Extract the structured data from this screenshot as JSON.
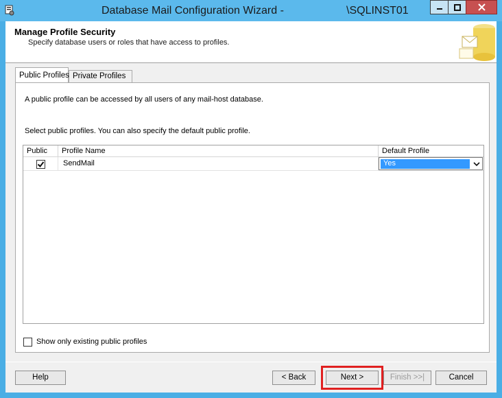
{
  "window": {
    "title": "Database Mail Configuration Wizard -",
    "title_instance": "\\SQLINST01",
    "title_bar_color": "#5bb9ec",
    "close_color": "#c75050"
  },
  "header": {
    "title": "Manage Profile Security",
    "subtitle": "Specify database users or roles that have access to profiles."
  },
  "tabs": [
    {
      "label": "Public Profiles",
      "active": true
    },
    {
      "label": "Private Profiles",
      "active": false
    }
  ],
  "public_tab": {
    "description": "A public profile can be accessed by all users of any mail-host database.",
    "instruction": "Select public profiles. You can also specify the default public profile.",
    "grid": {
      "columns": [
        "Public",
        "Profile Name",
        "Default Profile"
      ],
      "rows": [
        {
          "public": true,
          "profile_name": "SendMail",
          "default_profile": "Yes"
        }
      ]
    },
    "show_existing_label": "Show only existing public profiles",
    "show_existing_checked": false
  },
  "buttons": {
    "help": "Help",
    "back": "< Back",
    "next": "Next >",
    "finish": "Finish >>|",
    "cancel": "Cancel"
  },
  "highlight_color": "#e02020",
  "selection_color": "#3399ff"
}
